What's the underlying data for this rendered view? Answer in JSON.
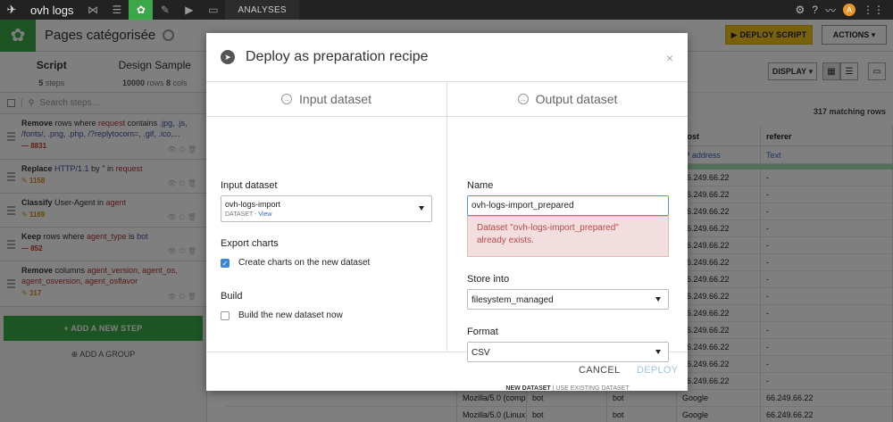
{
  "topnav": {
    "project": "ovh logs",
    "section": "ANALYSES",
    "avatar_letter": "A"
  },
  "header": {
    "title": "Pages catégorisée",
    "deploy_script": "DEPLOY SCRIPT",
    "actions": "ACTIONS"
  },
  "left": {
    "tabs": [
      {
        "label": "Script",
        "sub_a": "5",
        "sub_b": "steps"
      },
      {
        "label": "Design Sample",
        "sub_a": "10000",
        "sub_b": "rows",
        "sub_c": "8",
        "sub_d": "cols"
      }
    ],
    "search_placeholder": "Search steps...",
    "steps": [
      {
        "verb": "Remove",
        "p1": " rows where ",
        "kw": "request",
        "p2": " contains ",
        "val": ".jpg, .js, /fonts/, .png, .php, /?replytocom=, .gif, .ico,...",
        "count": "8831"
      },
      {
        "verb": "Replace",
        "p1": " ",
        "kw": "HTTP/1.1",
        "p2": " by '' in ",
        "val": "request",
        "count": "1158"
      },
      {
        "verb": "Classify",
        "p1": " User-Agent in ",
        "kw": "agent",
        "p2": "",
        "val": "",
        "count": "1169"
      },
      {
        "verb": "Keep",
        "p1": " rows where ",
        "kw": "agent_type",
        "p2": " is ",
        "val": "bot",
        "count": "852"
      },
      {
        "verb": "Remove",
        "p1": " columns ",
        "kw": "agent_version, agent_os, agent_osversion, agent_osflavor",
        "p2": "",
        "val": "",
        "count": "317"
      }
    ],
    "add_step": "+ ADD A NEW STEP",
    "add_group": "ADD A GROUP"
  },
  "table": {
    "display": "DISPLAY",
    "matching": "317 matching rows",
    "headers": [
      "",
      "",
      "",
      "",
      "host",
      "referer"
    ],
    "meanings": [
      "",
      "",
      "",
      "",
      "IP address",
      "Text"
    ],
    "rows": [
      [
        "",
        "",
        "",
        "",
        "66.249.66.22",
        "-"
      ],
      [
        "",
        "",
        "",
        "",
        "66.249.66.22",
        "-"
      ],
      [
        "",
        "",
        "",
        "",
        "66.249.66.22",
        "-"
      ],
      [
        "",
        "",
        "",
        "",
        "66.249.66.22",
        "-"
      ],
      [
        "",
        "",
        "",
        "",
        "66.249.66.22",
        "-"
      ],
      [
        "",
        "",
        "",
        "",
        "66.249.66.22",
        "-"
      ],
      [
        "",
        "",
        "",
        "",
        "66.249.66.22",
        "-"
      ],
      [
        "",
        "",
        "",
        "",
        "66.249.66.22",
        "-"
      ],
      [
        "",
        "",
        "",
        "",
        "66.249.66.22",
        "-"
      ],
      [
        "",
        "",
        "",
        "",
        "66.249.66.22",
        "-"
      ],
      [
        "",
        "",
        "",
        "",
        "66.249.66.22",
        "-"
      ],
      [
        "",
        "",
        "",
        "",
        "66.249.66.22",
        "-"
      ],
      [
        "",
        "",
        "",
        "",
        "66.249.66.22",
        "-"
      ],
      [
        "",
        "Mozilla/5.0 (compatible; Googlebot/2.1; +http://w...",
        "bot",
        "bot",
        "Google",
        "66.249.66.22"
      ],
      [
        "",
        "Mozilla/5.0 (Linux; Android 6.0.1; Nexus 5X Build/M...",
        "bot",
        "bot",
        "Google",
        "66.249.66.22"
      ]
    ]
  },
  "modal": {
    "title": "Deploy as preparation recipe",
    "close": "×",
    "input_col_title": "Input dataset",
    "output_col_title": "Output dataset",
    "input_label": "Input dataset",
    "input_dataset_name": "ovh-logs-import",
    "input_dataset_sub": "DATASET - ",
    "input_dataset_view": "View",
    "export_charts_label": "Export charts",
    "create_charts": "Create charts on the new dataset",
    "build_label": "Build",
    "build_now": "Build the new dataset now",
    "name_label": "Name",
    "name_value": "ovh-logs-import_prepared",
    "error_line1": "Dataset \"ovh-logs-import_prepared\"",
    "error_line2": "already exists.",
    "store_label": "Store into",
    "store_value": "filesystem_managed",
    "format_label": "Format",
    "format_value": "CSV",
    "new_dataset": "NEW DATASET",
    "use_existing": "USE EXISTING DATASET",
    "cancel": "CANCEL",
    "deploy": "DEPLOY"
  }
}
